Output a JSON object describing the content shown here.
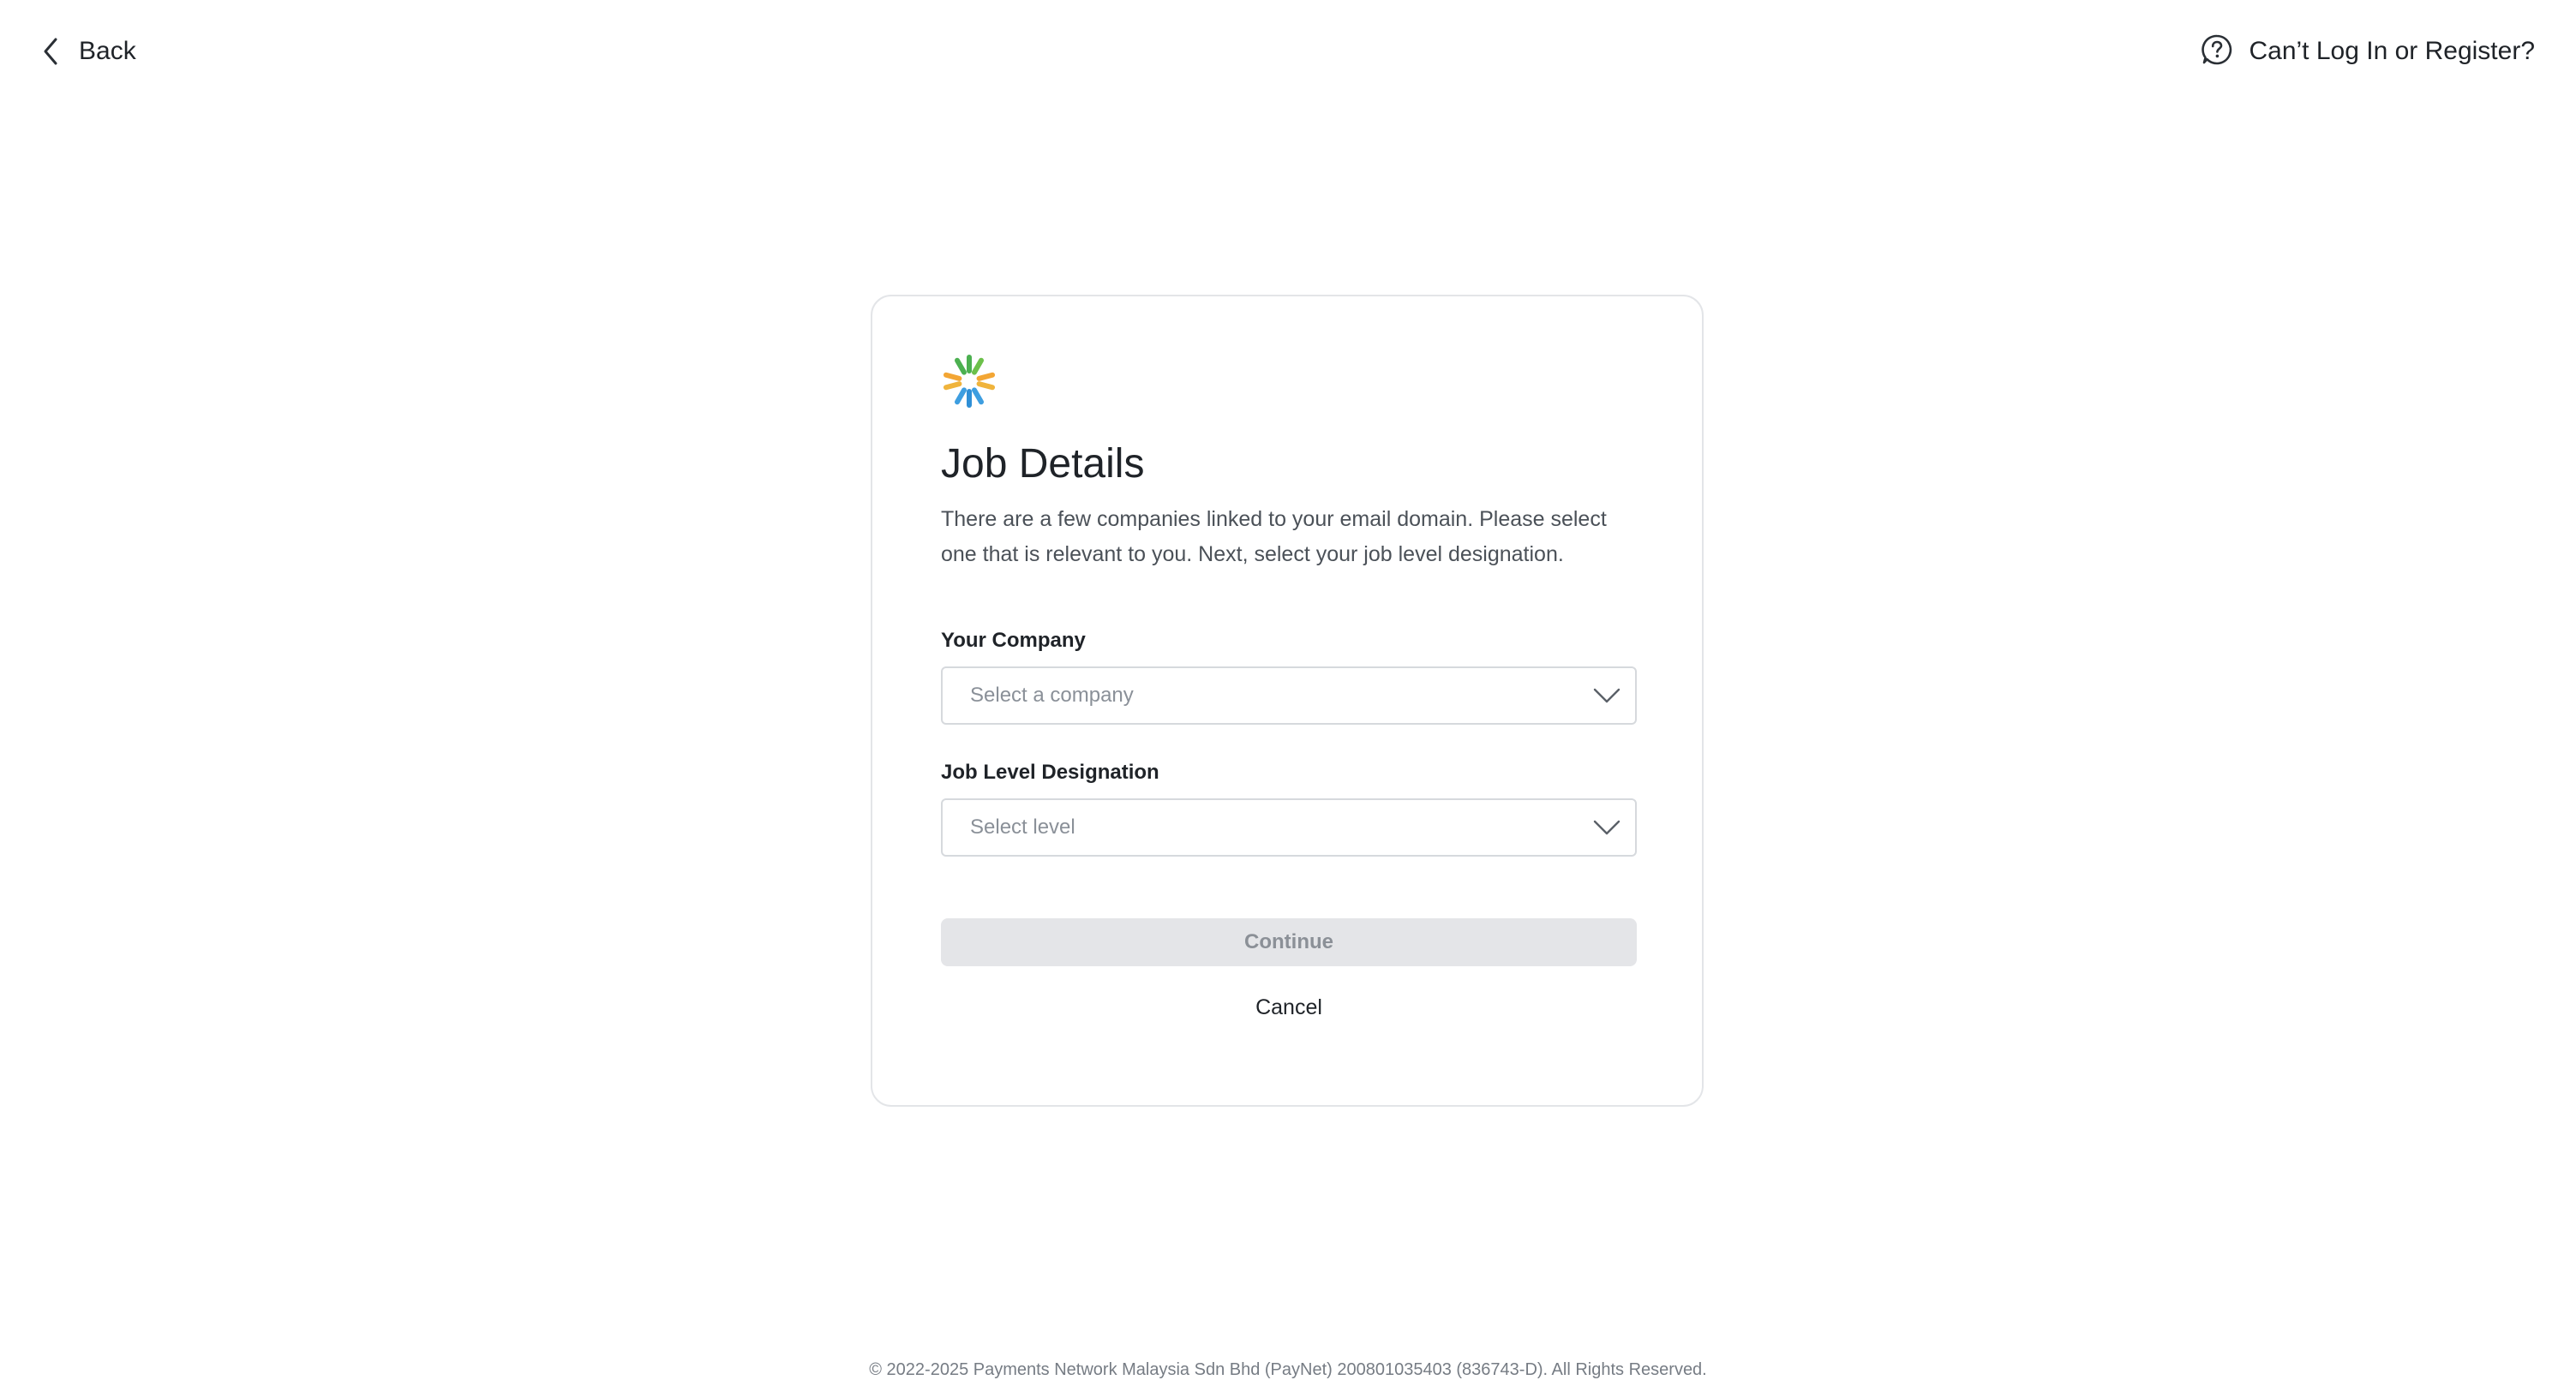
{
  "header": {
    "back_label": "Back",
    "back_icon": "chevron-left-icon",
    "help_label": "Can’t Log In or Register?",
    "help_icon": "question-bubble-icon"
  },
  "card": {
    "logo_icon": "paynet-starburst-logo",
    "title": "Job Details",
    "description": "There are a few companies linked to your email domain. Please select one that is relevant to you. Next, select your job level designation.",
    "company_field": {
      "label": "Your Company",
      "placeholder": "Select a company"
    },
    "level_field": {
      "label": "Job Level Designation",
      "placeholder": "Select level"
    },
    "continue_label": "Continue",
    "cancel_label": "Cancel"
  },
  "footer": {
    "text": "© 2022-2025 Payments Network Malaysia Sdn Bhd (PayNet) 200801035403 (836743-D). All Rights Reserved."
  },
  "colors": {
    "logo_green": "#4cb050",
    "logo_orange": "#f3a634",
    "logo_blue": "#3e9ee0",
    "button_disabled_bg": "#e4e5e8",
    "card_border": "#e3e5e8"
  }
}
